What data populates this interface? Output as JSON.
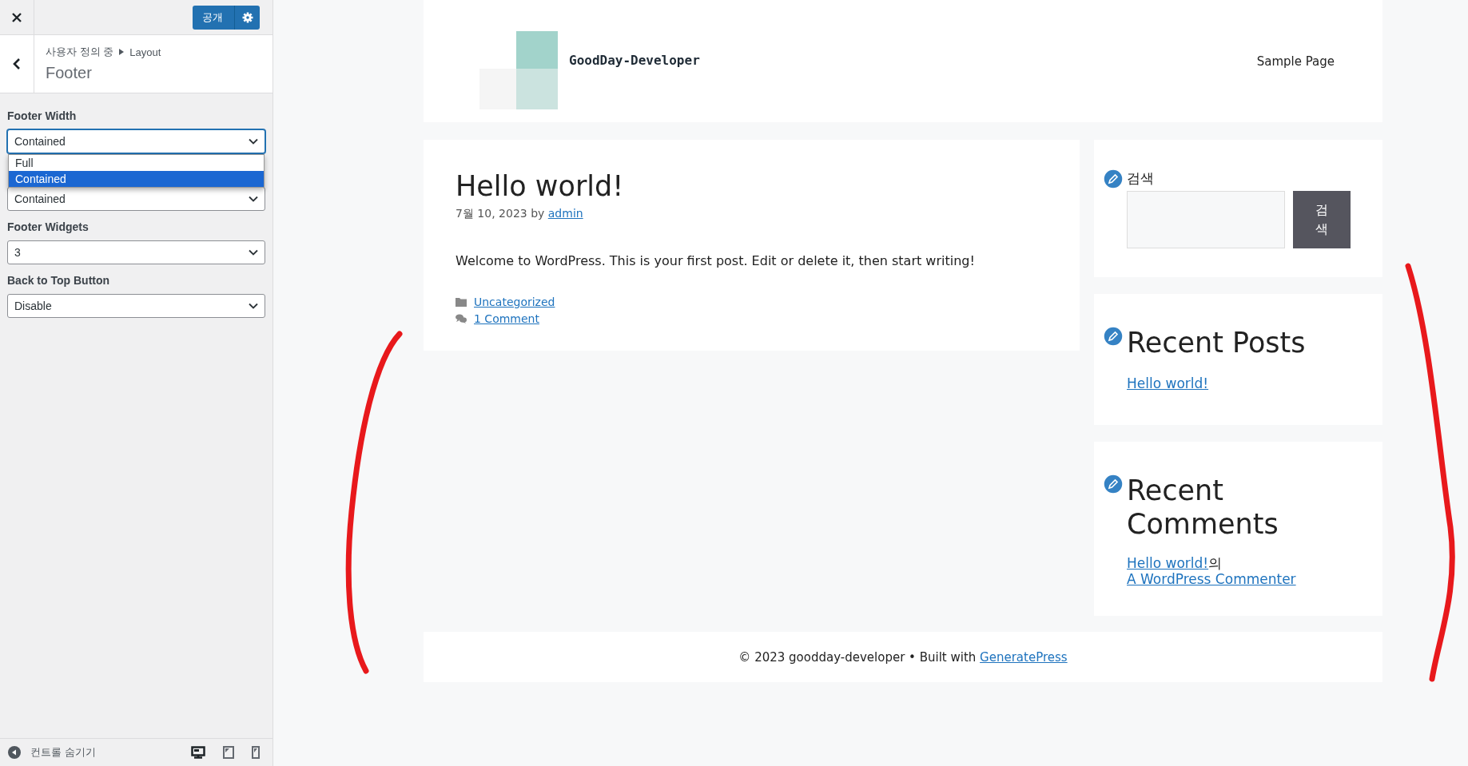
{
  "panel": {
    "publish_button": "공개",
    "breadcrumb": {
      "parent": "사용자 정의 중",
      "section": "Layout"
    },
    "title": "Footer",
    "controls": [
      {
        "label": "Footer Width",
        "value": "Contained",
        "open": true,
        "options": [
          {
            "label": "Full",
            "selected": false
          },
          {
            "label": "Contained",
            "selected": true
          }
        ]
      },
      {
        "value": "Contained",
        "open": false
      },
      {
        "label": "Footer Widgets",
        "value": "3",
        "open": false
      },
      {
        "label": "Back to Top Button",
        "value": "Disable",
        "open": false
      }
    ],
    "hide_controls": "컨트롤 숨기기",
    "devices": [
      {
        "kind": "desktop",
        "selected": true
      },
      {
        "kind": "tablet",
        "selected": false
      },
      {
        "kind": "mobile",
        "selected": false
      }
    ]
  },
  "site": {
    "title": "GoodDay-Developer",
    "nav": [
      "Sample Page"
    ]
  },
  "post": {
    "title": "Hello world!",
    "date": "7월 10, 2023",
    "by": "by",
    "author": "admin",
    "body": "Welcome to WordPress. This is your first post. Edit or delete it, then start writing!",
    "category": "Uncategorized",
    "comments": "1 Comment"
  },
  "widgets": [
    {
      "kind": "search",
      "title": "검색",
      "button": "검\n색"
    },
    {
      "kind": "recent_posts",
      "title": "Recent Posts",
      "links": [
        "Hello world!"
      ]
    },
    {
      "kind": "recent_comments",
      "title": "Recent Comments",
      "comments": [
        {
          "post": "Hello world!",
          "connector": "의",
          "author": "A WordPress Commenter"
        }
      ]
    }
  ],
  "footer": {
    "text": "© 2023 goodday-developer • Built with",
    "link": "GeneratePress"
  }
}
